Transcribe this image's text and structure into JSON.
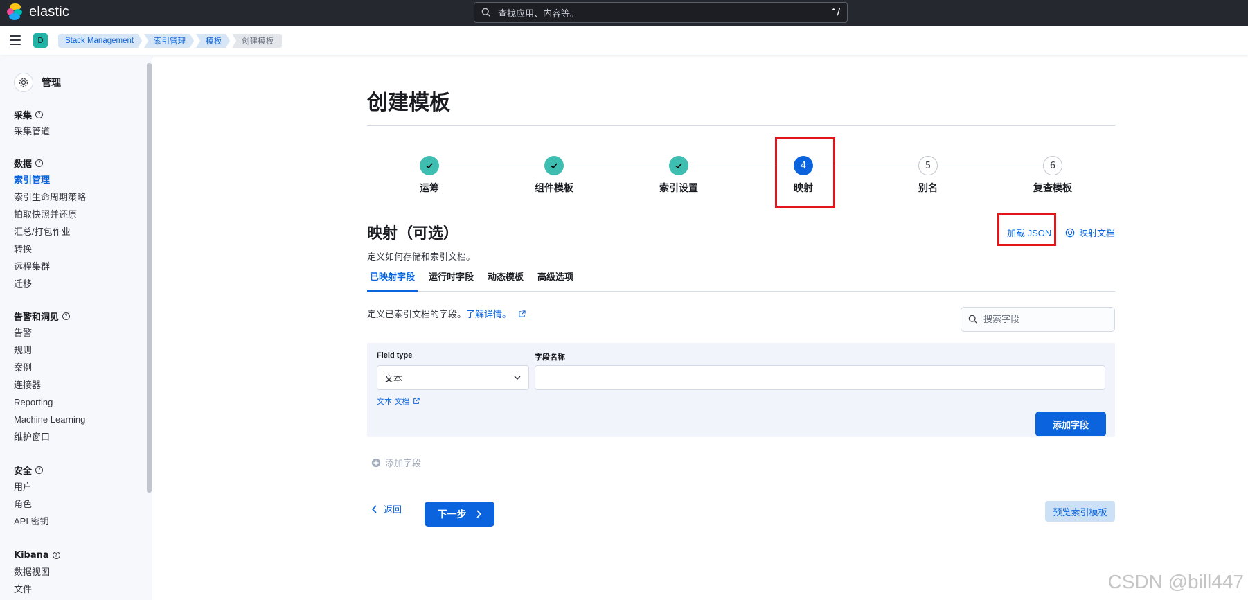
{
  "app": {
    "brand": "elastic",
    "search_placeholder": "查找应用、内容等。",
    "search_shortcut": "⌃/",
    "space_initial": "D"
  },
  "breadcrumbs": [
    "Stack Management",
    "索引管理",
    "模板",
    "创建模板"
  ],
  "sidebar": {
    "title": "管理",
    "groups": [
      {
        "title": "采集",
        "items": [
          "采集管道"
        ]
      },
      {
        "title": "数据",
        "items": [
          "索引管理",
          "索引生命周期策略",
          "拍取快照并还原",
          "汇总/打包作业",
          "转换",
          "远程集群",
          "迁移"
        ]
      },
      {
        "title": "告警和洞见",
        "items": [
          "告警",
          "规则",
          "案例",
          "连接器",
          "Reporting",
          "Machine Learning",
          "维护窗口"
        ]
      },
      {
        "title": "安全",
        "items": [
          "用户",
          "角色",
          "API 密钥"
        ]
      },
      {
        "title": "Kibana",
        "items": [
          "数据视图",
          "文件"
        ]
      }
    ],
    "active_item": "索引管理"
  },
  "page": {
    "title": "创建模板",
    "steps": [
      {
        "number": "1",
        "label": "运筹",
        "status": "done"
      },
      {
        "number": "2",
        "label": "组件模板",
        "status": "done"
      },
      {
        "number": "3",
        "label": "索引设置",
        "status": "done"
      },
      {
        "number": "4",
        "label": "映射",
        "status": "current"
      },
      {
        "number": "5",
        "label": "别名",
        "status": "todo"
      },
      {
        "number": "6",
        "label": "复查模板",
        "status": "todo"
      }
    ],
    "section_title": "映射（可选）",
    "section_description": "定义如何存储和索引文档。",
    "load_json": "加载 JSON",
    "mapping_docs": "映射文档",
    "tabs": [
      "已映射字段",
      "运行时字段",
      "动态模板",
      "高级选项"
    ],
    "active_tab": "已映射字段",
    "fields_description": "定义已索引文档的字段。",
    "learn_more": "了解详情。",
    "search_fields_placeholder": "搜索字段",
    "create_field": {
      "field_type_label": "Field type",
      "field_type_value": "文本",
      "field_name_label": "字段名称",
      "field_name_value": "",
      "type_doc_link": "文本 文档",
      "add_button": "添加字段"
    },
    "add_field_link": "添加字段",
    "back_button": "返回",
    "next_button": "下一步",
    "preview_button": "预览索引模板"
  },
  "watermark": "CSDN @bill447",
  "colors": {
    "primary": "#0b64dd",
    "step_done": "#3ebeb0",
    "highlight": "#e0161a",
    "header_bg": "#25282f"
  }
}
